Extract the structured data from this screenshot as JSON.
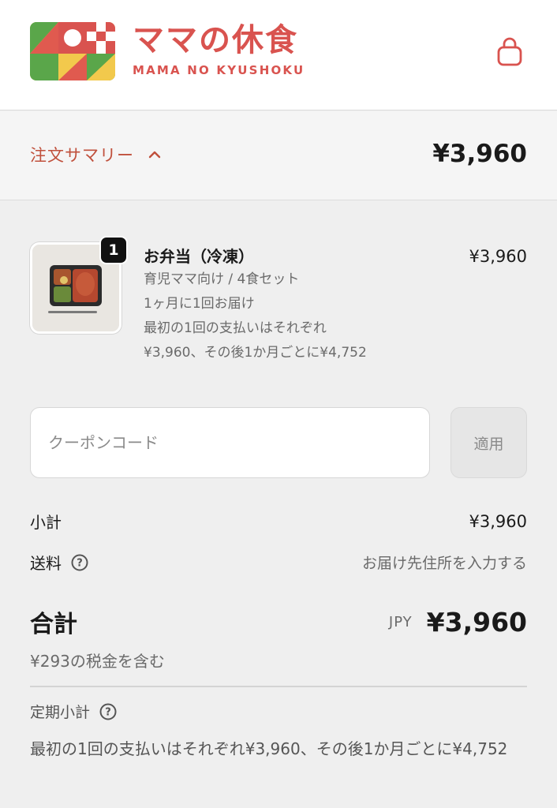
{
  "colors": {
    "brand": "#d9534f",
    "summary_accent": "#c0503c"
  },
  "header": {
    "logo_jp": "ママの休食",
    "logo_en": "MAMA NO KYUSHOKU",
    "cart_icon": "shopping-bag-icon"
  },
  "summary": {
    "toggle_label": "注文サマリー",
    "toggle_icon": "chevron-up-icon",
    "total": "¥3,960"
  },
  "item": {
    "quantity": "1",
    "title": "お弁当（冷凍）",
    "variant": "育児ママ向け / 4食セット",
    "delivery": "1ヶ月に1回お届け",
    "payment_line1": "最初の1回の支払いはそれぞれ",
    "payment_line2": "¥3,960、その後1か月ごとに¥4,752",
    "price": "¥3,960"
  },
  "coupon": {
    "placeholder": "クーポンコード",
    "apply_label": "適用"
  },
  "totals": {
    "subtotal_label": "小計",
    "subtotal_value": "¥3,960",
    "shipping_label": "送料",
    "shipping_value": "お届け先住所を入力する",
    "total_label": "合計",
    "currency": "JPY",
    "total_value": "¥3,960",
    "tax_note": "¥293の税金を含む"
  },
  "recurring": {
    "label": "定期小計",
    "text": "最初の1回の支払いはそれぞれ¥3,960、その後1か月ごとに¥4,752"
  }
}
